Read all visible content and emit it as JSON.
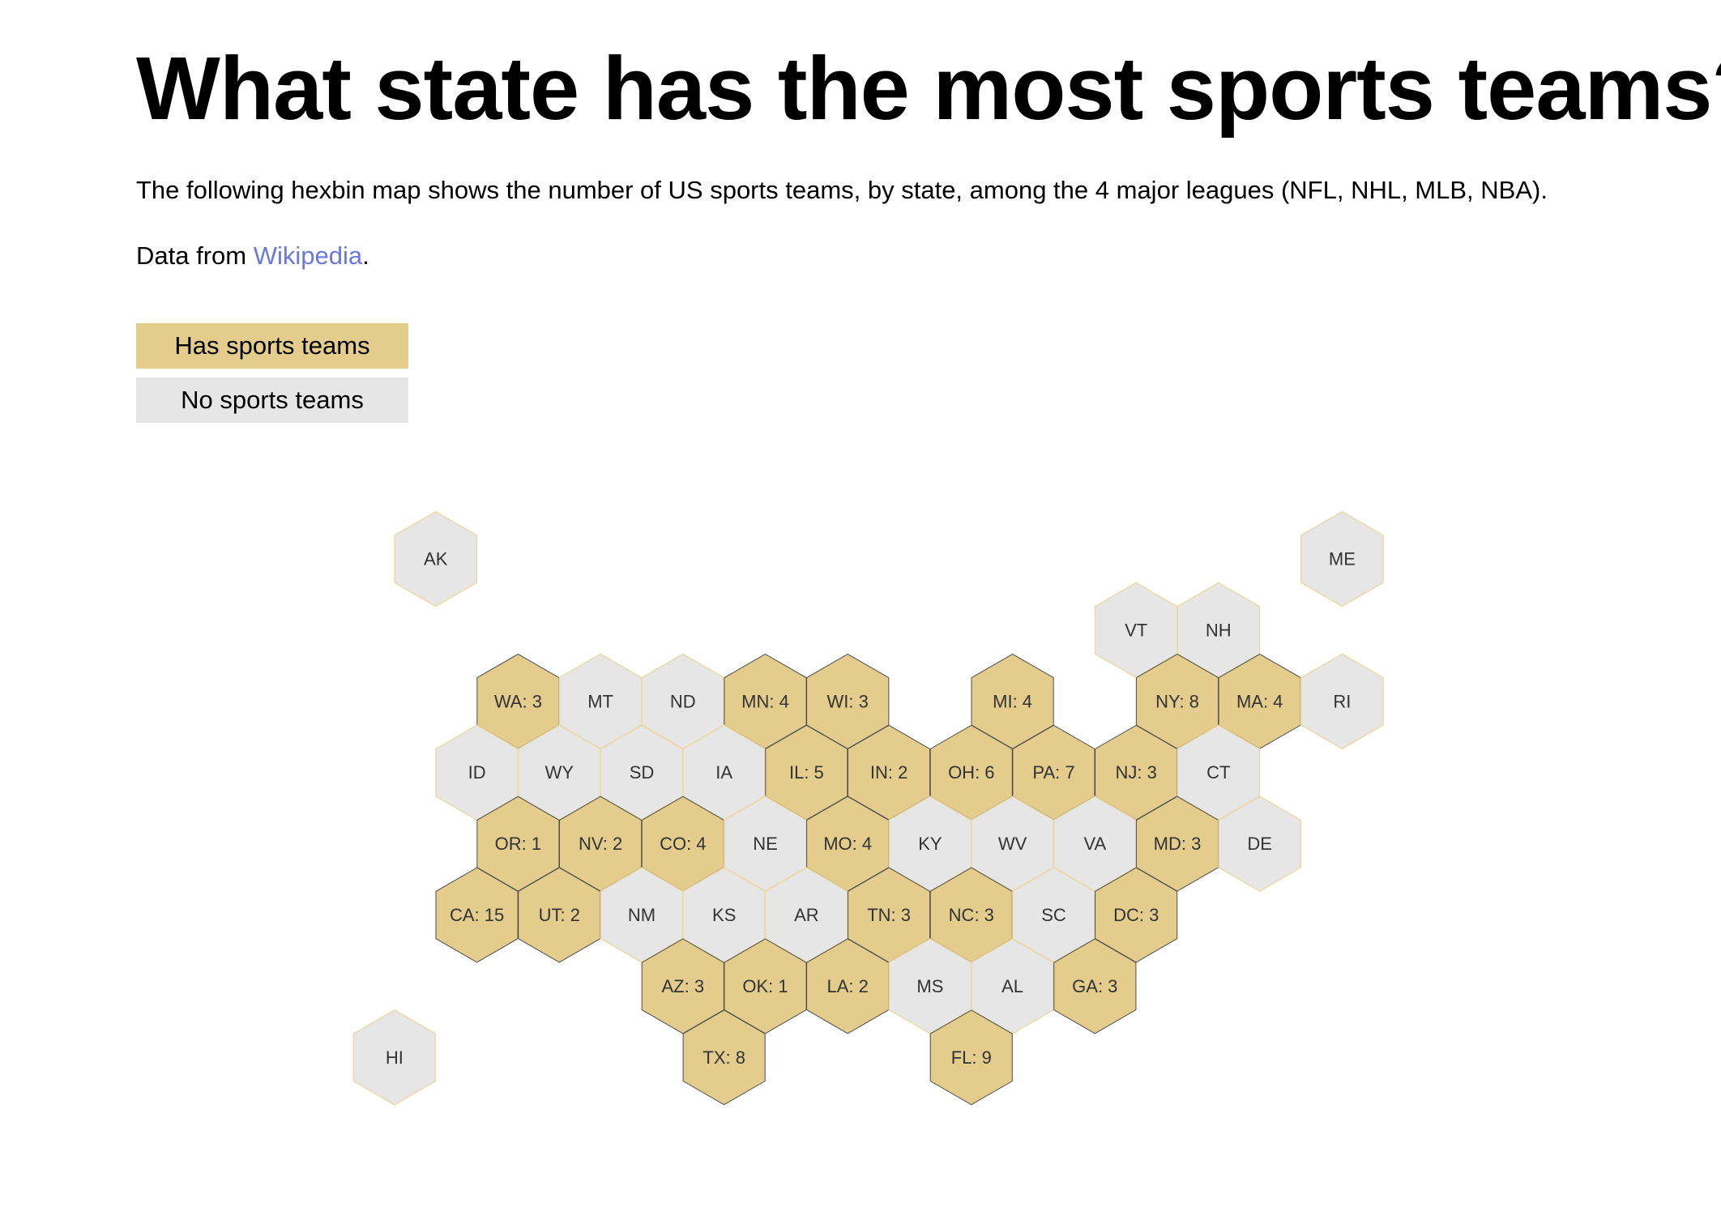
{
  "title": "What state has the most sports teams?",
  "intro": "The following hexbin map shows the number of US sports teams, by state, among the 4 major leagues (NFL, NHL, MLB, NBA).",
  "source": {
    "prefix": "Data from ",
    "link_text": "Wikipedia",
    "suffix": "."
  },
  "legend": {
    "has_label": "Has sports teams",
    "none_label": "No sports teams"
  },
  "colors": {
    "has_teams": "#e3cc8c",
    "no_teams": "#e6e6e6",
    "has_teams_stroke": "#4d4d4d",
    "no_teams_stroke": "#ecd9a8",
    "link": "#6a77e0"
  },
  "chart_data": {
    "type": "hexbin-map",
    "title": "What state has the most sports teams?",
    "states": [
      {
        "code": "AK",
        "teams": 0
      },
      {
        "code": "ME",
        "teams": 0
      },
      {
        "code": "VT",
        "teams": 0
      },
      {
        "code": "NH",
        "teams": 0
      },
      {
        "code": "WA",
        "teams": 3
      },
      {
        "code": "MT",
        "teams": 0
      },
      {
        "code": "ND",
        "teams": 0
      },
      {
        "code": "MN",
        "teams": 4
      },
      {
        "code": "WI",
        "teams": 3
      },
      {
        "code": "MI",
        "teams": 4
      },
      {
        "code": "NY",
        "teams": 8
      },
      {
        "code": "MA",
        "teams": 4
      },
      {
        "code": "RI",
        "teams": 0
      },
      {
        "code": "ID",
        "teams": 0
      },
      {
        "code": "WY",
        "teams": 0
      },
      {
        "code": "SD",
        "teams": 0
      },
      {
        "code": "IA",
        "teams": 0
      },
      {
        "code": "IL",
        "teams": 5
      },
      {
        "code": "IN",
        "teams": 2
      },
      {
        "code": "OH",
        "teams": 6
      },
      {
        "code": "PA",
        "teams": 7
      },
      {
        "code": "NJ",
        "teams": 3
      },
      {
        "code": "CT",
        "teams": 0
      },
      {
        "code": "OR",
        "teams": 1
      },
      {
        "code": "NV",
        "teams": 2
      },
      {
        "code": "CO",
        "teams": 4
      },
      {
        "code": "NE",
        "teams": 0
      },
      {
        "code": "MO",
        "teams": 4
      },
      {
        "code": "KY",
        "teams": 0
      },
      {
        "code": "WV",
        "teams": 0
      },
      {
        "code": "VA",
        "teams": 0
      },
      {
        "code": "MD",
        "teams": 3
      },
      {
        "code": "DE",
        "teams": 0
      },
      {
        "code": "CA",
        "teams": 15
      },
      {
        "code": "UT",
        "teams": 2
      },
      {
        "code": "NM",
        "teams": 0
      },
      {
        "code": "KS",
        "teams": 0
      },
      {
        "code": "AR",
        "teams": 0
      },
      {
        "code": "TN",
        "teams": 3
      },
      {
        "code": "NC",
        "teams": 3
      },
      {
        "code": "SC",
        "teams": 0
      },
      {
        "code": "DC",
        "teams": 3
      },
      {
        "code": "AZ",
        "teams": 3
      },
      {
        "code": "OK",
        "teams": 1
      },
      {
        "code": "LA",
        "teams": 2
      },
      {
        "code": "MS",
        "teams": 0
      },
      {
        "code": "AL",
        "teams": 0
      },
      {
        "code": "GA",
        "teams": 3
      },
      {
        "code": "HI",
        "teams": 0
      },
      {
        "code": "TX",
        "teams": 8
      },
      {
        "code": "FL",
        "teams": 9
      }
    ]
  }
}
